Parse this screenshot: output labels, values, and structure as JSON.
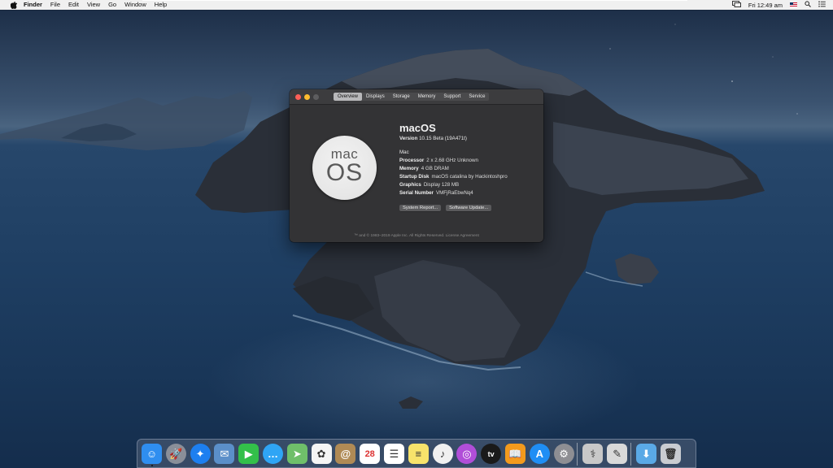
{
  "menubar": {
    "apple_icon": "apple-icon",
    "items": [
      "Finder",
      "File",
      "Edit",
      "View",
      "Go",
      "Window",
      "Help"
    ],
    "clock": "Fri 12:49 am",
    "status_icons": [
      "display-mirror-icon",
      "us-flag-icon",
      "search-icon",
      "notification-center-icon"
    ]
  },
  "window": {
    "tabs": [
      "Overview",
      "Displays",
      "Storage",
      "Memory",
      "Support",
      "Service"
    ],
    "active_tab": "Overview",
    "logo_top": "mac",
    "logo_bottom": "OS",
    "os_name": "macOS",
    "version_label": "Version",
    "version_value": "10.15 Beta (19A471t)",
    "model": "Mac",
    "specs": [
      {
        "key": "Processor",
        "value": "2 x 2.68 GHz Unknown"
      },
      {
        "key": "Memory",
        "value": "4 GB DRAM"
      },
      {
        "key": "Startup Disk",
        "value": "macOS catalina by Hackintoshpro"
      },
      {
        "key": "Graphics",
        "value": "Display 128 MB"
      },
      {
        "key": "Serial Number",
        "value": "VMFjRaEbwNq4"
      }
    ],
    "buttons": {
      "system_report": "System Report...",
      "software_update": "Software Update..."
    },
    "footer": "™ and © 1983–2019 Apple Inc. All Rights Reserved. License Agreement"
  },
  "dock": {
    "apps": [
      {
        "name": "finder-icon",
        "glyph": "☺",
        "color": "#2f8ef0"
      },
      {
        "name": "launchpad-icon",
        "glyph": "🚀",
        "color": "#8a8f99"
      },
      {
        "name": "safari-icon",
        "glyph": "✦",
        "color": "#1d7ff0"
      },
      {
        "name": "mail-stamp-icon",
        "glyph": "✉",
        "color": "#5b8fc9"
      },
      {
        "name": "facetime-icon",
        "glyph": "▶",
        "color": "#33c04a"
      },
      {
        "name": "messages-icon",
        "glyph": "…",
        "color": "#2fa5f5"
      },
      {
        "name": "maps-icon",
        "glyph": "➤",
        "color": "#6fbf6a"
      },
      {
        "name": "photos-icon",
        "glyph": "✿",
        "color": "#f5f5f5"
      },
      {
        "name": "contacts-icon",
        "glyph": "@",
        "color": "#b08a55"
      },
      {
        "name": "calendar-icon",
        "glyph": "28",
        "color": "#ffffff"
      },
      {
        "name": "reminders-icon",
        "glyph": "☰",
        "color": "#ffffff"
      },
      {
        "name": "notes-icon",
        "glyph": "≡",
        "color": "#f7e36b"
      },
      {
        "name": "music-icon",
        "glyph": "♪",
        "color": "#f0f0f0"
      },
      {
        "name": "podcasts-icon",
        "glyph": "◎",
        "color": "#b14ed8"
      },
      {
        "name": "apple-tv-icon",
        "glyph": "tv",
        "color": "#1a1a1a"
      },
      {
        "name": "books-icon",
        "glyph": "📖",
        "color": "#f39a1d"
      },
      {
        "name": "app-store-icon",
        "glyph": "A",
        "color": "#1f8ef5"
      },
      {
        "name": "system-preferences-icon",
        "glyph": "⚙",
        "color": "#8e8e93"
      },
      {
        "name": "disk-utility-icon",
        "glyph": "⚕",
        "color": "#c8c8c8"
      },
      {
        "name": "script-editor-icon",
        "glyph": "✎",
        "color": "#d9d9d9"
      },
      {
        "name": "downloads-folder-icon",
        "glyph": "⬇",
        "color": "#5aa9e6"
      },
      {
        "name": "trash-icon",
        "glyph": "🗑",
        "color": "#c9ccd1"
      }
    ]
  }
}
